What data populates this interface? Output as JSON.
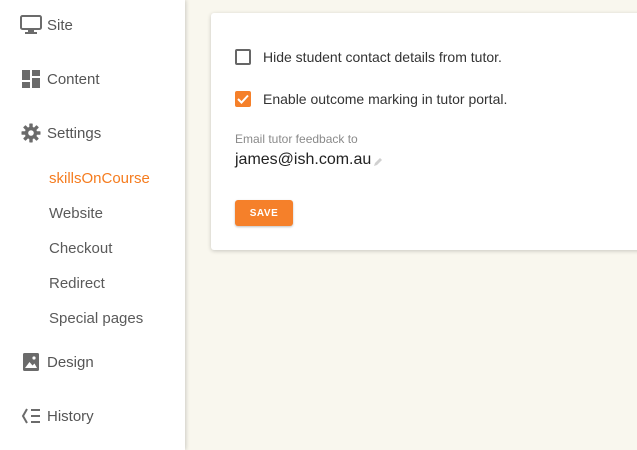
{
  "colors": {
    "accent": "#f57c1f",
    "page_bg": "#f9f7ee",
    "sidebar_bg": "#ffffff",
    "text_muted": "#555555"
  },
  "sidebar": {
    "items": [
      {
        "label": "Site",
        "icon": "monitor-icon"
      },
      {
        "label": "Content",
        "icon": "dashboard-icon"
      },
      {
        "label": "Settings",
        "icon": "gear-icon"
      },
      {
        "label": "Design",
        "icon": "image-icon"
      },
      {
        "label": "History",
        "icon": "history-icon"
      }
    ],
    "settings_subitems": [
      {
        "label": "skillsOnCourse",
        "active": true
      },
      {
        "label": "Website"
      },
      {
        "label": "Checkout"
      },
      {
        "label": "Redirect"
      },
      {
        "label": "Special pages"
      }
    ]
  },
  "form": {
    "hide_contact": {
      "label": "Hide student contact details from tutor.",
      "checked": false
    },
    "enable_outcome": {
      "label": "Enable outcome marking in tutor portal.",
      "checked": true
    },
    "email_label": "Email tutor feedback to",
    "email_value": "james@ish.com.au",
    "save_label": "SAVE"
  }
}
